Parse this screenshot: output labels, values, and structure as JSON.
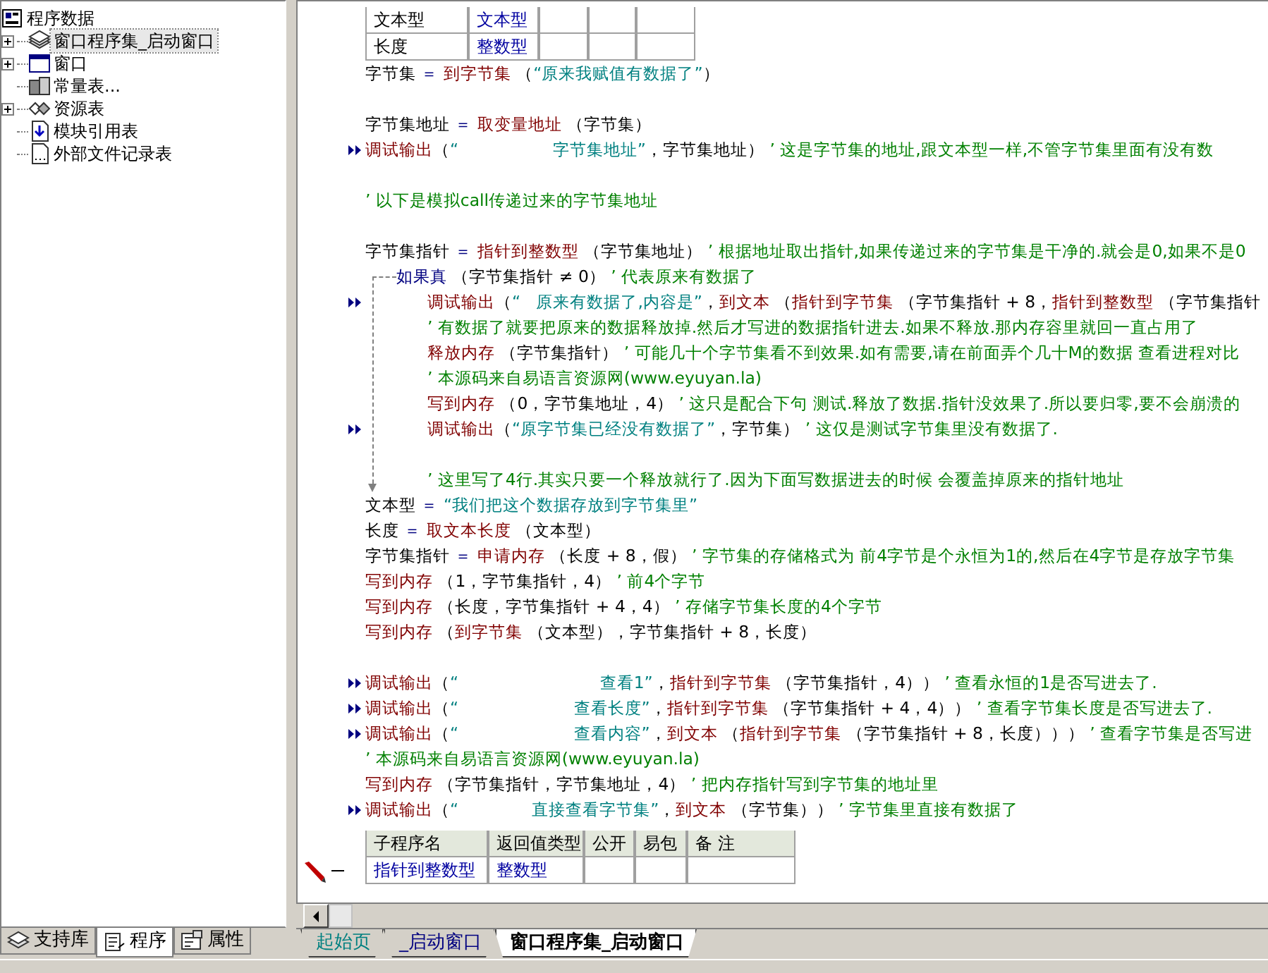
{
  "project_tree": {
    "root": {
      "label": "程序数据",
      "children": [
        {
          "label": "窗口程序集_启动窗口",
          "kind": "class-module",
          "collapsed": true,
          "selected": true
        },
        {
          "label": "窗口",
          "kind": "window",
          "collapsed": true,
          "selected": false
        },
        {
          "label": "常量表...",
          "kind": "constants",
          "collapsed": false,
          "selected": false
        },
        {
          "label": "资源表",
          "kind": "resources",
          "collapsed": true,
          "selected": false
        },
        {
          "label": "模块引用表",
          "kind": "module-ref",
          "collapsed": false,
          "selected": false
        },
        {
          "label": "外部文件记录表",
          "kind": "file-list",
          "collapsed": false,
          "selected": false
        }
      ]
    }
  },
  "panel_tabs": [
    {
      "label": "支持库",
      "kind": "library",
      "selected": false
    },
    {
      "label": "程序",
      "kind": "program",
      "selected": true
    },
    {
      "label": "属性",
      "kind": "properties",
      "selected": false
    }
  ],
  "variable_table": {
    "rows": [
      {
        "column_1": "文本型",
        "column_2": "文本型"
      },
      {
        "column_1": "长度",
        "column_2": "整数型"
      }
    ]
  },
  "code_lines": [
    {
      "kind": "code",
      "debug": false,
      "segments": [
        {
          "kind": "plain",
          "text": "字节集 "
        },
        {
          "kind": "op",
          "text": "＝ "
        },
        {
          "kind": "func",
          "text": "到字节集"
        },
        {
          "kind": "plain",
          "text": " （"
        },
        {
          "kind": "string",
          "text": "“原来我赋值有数据了”"
        },
        {
          "kind": "plain",
          "text": "）"
        }
      ]
    },
    {
      "kind": "blank"
    },
    {
      "kind": "code",
      "debug": false,
      "segments": [
        {
          "kind": "plain",
          "text": "字节集地址 "
        },
        {
          "kind": "op",
          "text": "＝ "
        },
        {
          "kind": "func",
          "text": "取变量地址"
        },
        {
          "kind": "plain",
          "text": " （字节集）"
        }
      ]
    },
    {
      "kind": "code",
      "debug": true,
      "segments": [
        {
          "kind": "func",
          "text": "调试输出"
        },
        {
          "kind": "plain",
          "text": "（"
        },
        {
          "kind": "string",
          "text": "“                  字节集地址”"
        },
        {
          "kind": "plain",
          "text": "，字节集地址）"
        },
        {
          "kind": "comment",
          "text": " ’ 这是字节集的地址,跟文本型一样,不管字节集里面有没有数"
        }
      ]
    },
    {
      "kind": "blank"
    },
    {
      "kind": "code",
      "debug": false,
      "segments": [
        {
          "kind": "comment",
          "text": "’ 以下是模拟call传递过来的字节集地址"
        }
      ]
    },
    {
      "kind": "blank"
    },
    {
      "kind": "code",
      "debug": false,
      "segments": [
        {
          "kind": "plain",
          "text": "字节集指针 "
        },
        {
          "kind": "op",
          "text": "＝ "
        },
        {
          "kind": "func",
          "text": "指针到整数型"
        },
        {
          "kind": "plain",
          "text": " （字节集地址）"
        },
        {
          "kind": "comment",
          "text": " ’ 根据地址取出指针,如果传递过来的字节集是干净的.就会是0,如果不是0"
        }
      ]
    },
    {
      "kind": "block",
      "debug": false,
      "segments": [
        {
          "kind": "keyword",
          "text": "如果真"
        },
        {
          "kind": "plain",
          "text": " （字节集指针 ≠ 0）"
        },
        {
          "kind": "comment",
          "text": " ’ 代表原来有数据了"
        }
      ],
      "children": [
        {
          "kind": "code",
          "debug": true,
          "segments": [
            {
              "kind": "func",
              "text": "调试输出"
            },
            {
              "kind": "plain",
              "text": "（"
            },
            {
              "kind": "string",
              "text": "“   原来有数据了,内容是”"
            },
            {
              "kind": "plain",
              "text": "，"
            },
            {
              "kind": "func",
              "text": "到文本"
            },
            {
              "kind": "plain",
              "text": " （"
            },
            {
              "kind": "func",
              "text": "指针到字节集"
            },
            {
              "kind": "plain",
              "text": " （字节集指针 + 8，"
            },
            {
              "kind": "func",
              "text": "指针到整数型"
            },
            {
              "kind": "plain",
              "text": " （字节集指针"
            }
          ]
        },
        {
          "kind": "code",
          "debug": false,
          "segments": [
            {
              "kind": "comment",
              "text": "’ 有数据了就要把原来的数据释放掉.然后才写进的数据指针进去.如果不释放.那内存容里就回一直占用了"
            }
          ]
        },
        {
          "kind": "code",
          "debug": false,
          "segments": [
            {
              "kind": "func",
              "text": "释放内存"
            },
            {
              "kind": "plain",
              "text": " （字节集指针）"
            },
            {
              "kind": "comment",
              "text": " ’ 可能几十个字节集看不到效果.如有需要,请在前面弄个几十M的数据 查看进程对比"
            }
          ]
        },
        {
          "kind": "code",
          "debug": false,
          "segments": [
            {
              "kind": "comment",
              "text": "’ 本源码来自易语言资源网(www.eyuyan.la)"
            }
          ]
        },
        {
          "kind": "code",
          "debug": false,
          "segments": [
            {
              "kind": "func",
              "text": "写到内存"
            },
            {
              "kind": "plain",
              "text": " （0，字节集地址，4）"
            },
            {
              "kind": "comment",
              "text": " ’ 这只是配合下句 测试.释放了数据.指针没效果了.所以要归零,要不会崩溃的"
            }
          ]
        },
        {
          "kind": "code",
          "debug": true,
          "segments": [
            {
              "kind": "func",
              "text": "调试输出"
            },
            {
              "kind": "plain",
              "text": "（"
            },
            {
              "kind": "string",
              "text": "“原字节集已经没有数据了”"
            },
            {
              "kind": "plain",
              "text": "，字节集）"
            },
            {
              "kind": "comment",
              "text": " ’ 这仅是测试字节集里没有数据了."
            }
          ]
        },
        {
          "kind": "blank"
        },
        {
          "kind": "code",
          "debug": false,
          "segments": [
            {
              "kind": "comment",
              "text": "’ 这里写了4行.其实只要一个释放就行了.因为下面写数据进去的时候 会覆盖掉原来的指针地址"
            }
          ]
        }
      ]
    },
    {
      "kind": "code",
      "debug": false,
      "segments": [
        {
          "kind": "plain",
          "text": "文本型 "
        },
        {
          "kind": "op",
          "text": "＝ "
        },
        {
          "kind": "string",
          "text": "“我们把这个数据存放到字节集里”"
        }
      ]
    },
    {
      "kind": "code",
      "debug": false,
      "segments": [
        {
          "kind": "plain",
          "text": "长度 "
        },
        {
          "kind": "op",
          "text": "＝ "
        },
        {
          "kind": "func",
          "text": "取文本长度"
        },
        {
          "kind": "plain",
          "text": " （文本型）"
        }
      ]
    },
    {
      "kind": "code",
      "debug": false,
      "segments": [
        {
          "kind": "plain",
          "text": "字节集指针 "
        },
        {
          "kind": "op",
          "text": "＝ "
        },
        {
          "kind": "func",
          "text": "申请内存"
        },
        {
          "kind": "plain",
          "text": " （长度 + 8，假）"
        },
        {
          "kind": "comment",
          "text": " ’ 字节集的存储格式为 前4字节是个永恒为1的,然后在4字节是存放字节集"
        }
      ]
    },
    {
      "kind": "code",
      "debug": false,
      "segments": [
        {
          "kind": "func",
          "text": "写到内存"
        },
        {
          "kind": "plain",
          "text": " （1，字节集指针，4）"
        },
        {
          "kind": "comment",
          "text": " ’ 前4个字节"
        }
      ]
    },
    {
      "kind": "code",
      "debug": false,
      "segments": [
        {
          "kind": "func",
          "text": "写到内存"
        },
        {
          "kind": "plain",
          "text": " （长度，字节集指针 + 4，4）"
        },
        {
          "kind": "comment",
          "text": " ’ 存储字节集长度的4个字节"
        }
      ]
    },
    {
      "kind": "code",
      "debug": false,
      "segments": [
        {
          "kind": "func",
          "text": "写到内存"
        },
        {
          "kind": "plain",
          "text": " （"
        },
        {
          "kind": "func",
          "text": "到字节集"
        },
        {
          "kind": "plain",
          "text": " （文本型），字节集指针 + 8，长度）"
        }
      ]
    },
    {
      "kind": "blank"
    },
    {
      "kind": "code",
      "debug": true,
      "segments": [
        {
          "kind": "func",
          "text": "调试输出"
        },
        {
          "kind": "plain",
          "text": "（"
        },
        {
          "kind": "string",
          "text": "“                           查看1”"
        },
        {
          "kind": "plain",
          "text": "，"
        },
        {
          "kind": "func",
          "text": "指针到字节集"
        },
        {
          "kind": "plain",
          "text": " （字节集指针，4））"
        },
        {
          "kind": "comment",
          "text": " ’ 查看永恒的1是否写进去了."
        }
      ]
    },
    {
      "kind": "code",
      "debug": true,
      "segments": [
        {
          "kind": "func",
          "text": "调试输出"
        },
        {
          "kind": "plain",
          "text": "（"
        },
        {
          "kind": "string",
          "text": "“                      查看长度”"
        },
        {
          "kind": "plain",
          "text": "，"
        },
        {
          "kind": "func",
          "text": "指针到字节集"
        },
        {
          "kind": "plain",
          "text": " （字节集指针 + 4，4））"
        },
        {
          "kind": "comment",
          "text": " ’ 查看字节集长度是否写进去了."
        }
      ]
    },
    {
      "kind": "code",
      "debug": true,
      "segments": [
        {
          "kind": "func",
          "text": "调试输出"
        },
        {
          "kind": "plain",
          "text": "（"
        },
        {
          "kind": "string",
          "text": "“                      查看内容”"
        },
        {
          "kind": "plain",
          "text": "，"
        },
        {
          "kind": "func",
          "text": "到文本"
        },
        {
          "kind": "plain",
          "text": " （"
        },
        {
          "kind": "func",
          "text": "指针到字节集"
        },
        {
          "kind": "plain",
          "text": " （字节集指针 + 8，长度）））"
        },
        {
          "kind": "comment",
          "text": " ’ 查看字节集是否写进"
        }
      ]
    },
    {
      "kind": "code",
      "debug": false,
      "segments": [
        {
          "kind": "comment",
          "text": "’ 本源码来自易语言资源网(www.eyuyan.la)"
        }
      ]
    },
    {
      "kind": "code",
      "debug": false,
      "segments": [
        {
          "kind": "func",
          "text": "写到内存"
        },
        {
          "kind": "plain",
          "text": " （字节集指针，字节集地址，4）"
        },
        {
          "kind": "comment",
          "text": " ’ 把内存指针写到字节集的地址里"
        }
      ]
    },
    {
      "kind": "code",
      "debug": true,
      "segments": [
        {
          "kind": "func",
          "text": "调试输出"
        },
        {
          "kind": "plain",
          "text": "（"
        },
        {
          "kind": "string",
          "text": "“              直接查看字节集”"
        },
        {
          "kind": "plain",
          "text": "，"
        },
        {
          "kind": "func",
          "text": "到文本"
        },
        {
          "kind": "plain",
          "text": " （字节集））"
        },
        {
          "kind": "comment",
          "text": " ’ 字节集里直接有数据了"
        }
      ]
    }
  ],
  "subroutine_table": {
    "columns": [
      "子程序名",
      "返回值类型",
      "公开",
      "易包",
      "备 注"
    ],
    "rows": [
      {
        "editing": true,
        "cells": [
          "指针到整数型",
          "整数型"
        ]
      }
    ]
  },
  "document_tabs": [
    {
      "label": "起始页",
      "color": "#008080",
      "selected": false
    },
    {
      "label": "_启动窗口",
      "color": "#000080",
      "selected": false
    },
    {
      "label": "窗口程序集_启动窗口",
      "color": "#000000",
      "selected": true
    }
  ]
}
